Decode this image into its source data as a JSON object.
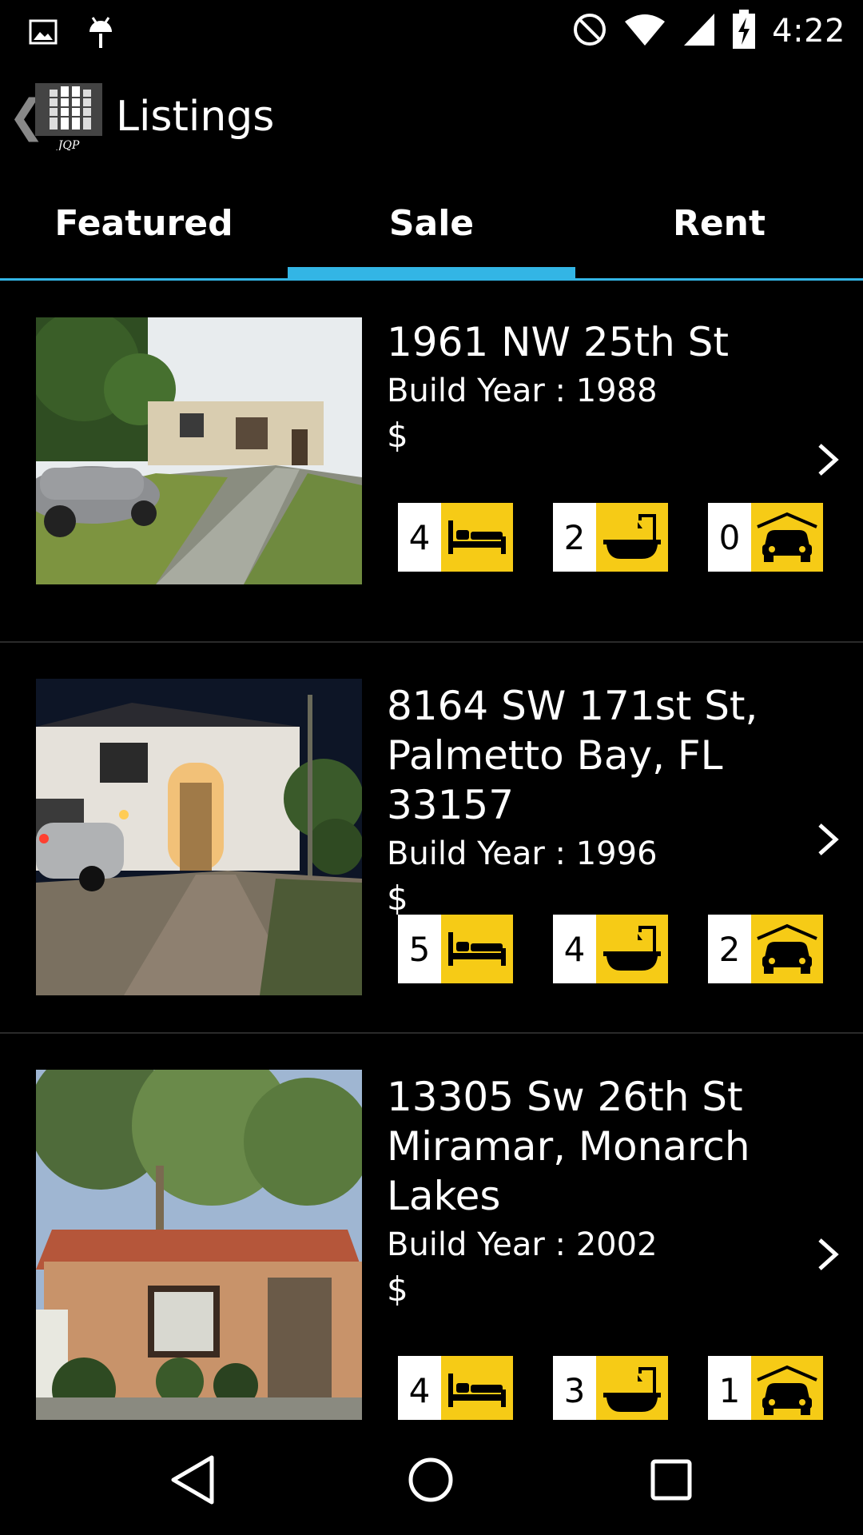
{
  "status_bar": {
    "time": "4:22",
    "left_icons": [
      "image-icon",
      "android-debug-icon"
    ],
    "right_icons": [
      "do-not-disturb-icon",
      "wifi-icon",
      "cell-signal-icon",
      "battery-charging-icon"
    ]
  },
  "app_bar": {
    "title": "Listings",
    "logo_text": "JQP"
  },
  "tabs": [
    {
      "label": "Featured",
      "selected": false
    },
    {
      "label": "Sale",
      "selected": true
    },
    {
      "label": "Rent",
      "selected": false
    }
  ],
  "listings": [
    {
      "address": "1961 NW 25th St",
      "build_year": "Build Year : 1988",
      "price": "$",
      "beds": "4",
      "baths": "2",
      "garage": "0"
    },
    {
      "address": "8164 SW 171st St, Palmetto Bay, FL 33157",
      "build_year": "Build Year : 1996",
      "price": "$",
      "beds": "5",
      "baths": "4",
      "garage": "2"
    },
    {
      "address": "13305 Sw 26th St Miramar, Monarch Lakes",
      "build_year": "Build Year : 2002",
      "price": "$",
      "beds": "4",
      "baths": "3",
      "garage": "1"
    }
  ],
  "colors": {
    "accent": "#33b5e5",
    "feature_icon_bg": "#f6cb16",
    "background": "#000000"
  }
}
